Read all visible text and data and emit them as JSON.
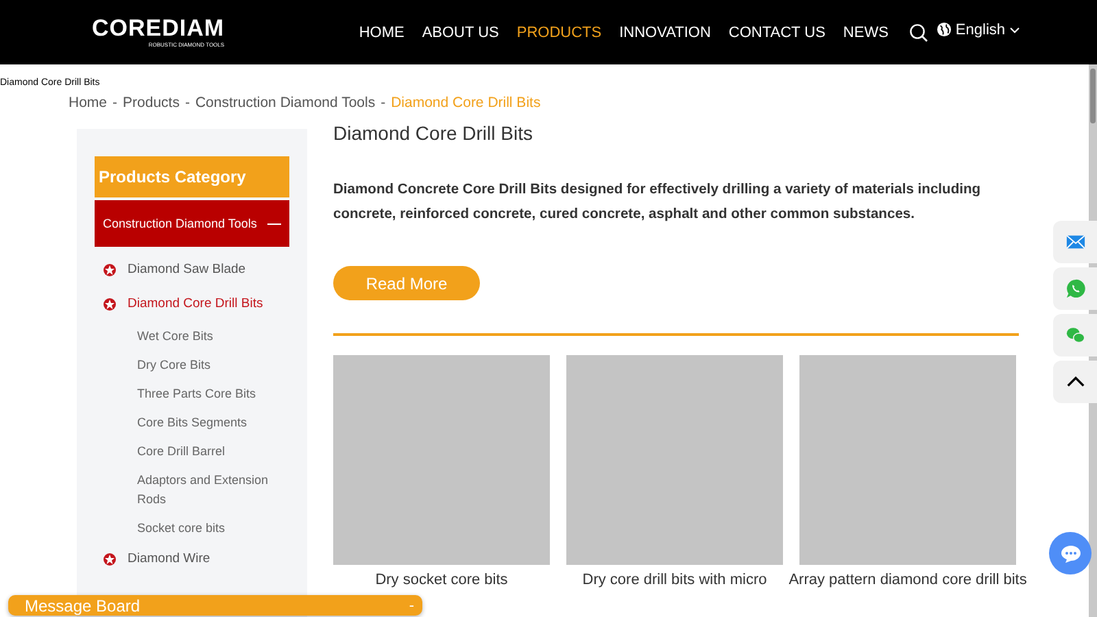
{
  "header": {
    "logo": "COREDIAM",
    "tagline": "ROBUSTIC DIAMOND TOOLS",
    "nav": [
      {
        "label": "HOME",
        "selected": false
      },
      {
        "label": "ABOUT US",
        "selected": false
      },
      {
        "label": "PRODUCTS",
        "selected": true
      },
      {
        "label": "INNOVATION",
        "selected": false
      },
      {
        "label": "CONTACT US",
        "selected": false
      },
      {
        "label": "NEWS",
        "selected": false
      }
    ],
    "language": "English"
  },
  "page_label": "Diamond Core Drill Bits",
  "breadcrumb": [
    {
      "kind": "link",
      "label": "Home",
      "selected": false
    },
    {
      "kind": "separator",
      "label": "-"
    },
    {
      "kind": "link",
      "label": "Products",
      "selected": false
    },
    {
      "kind": "separator",
      "label": "-"
    },
    {
      "kind": "link",
      "label": "Construction Diamond Tools",
      "selected": false
    },
    {
      "kind": "separator",
      "label": "-"
    },
    {
      "kind": "link",
      "label": "Diamond Core Drill Bits",
      "selected": true
    }
  ],
  "sidebar": {
    "title": "Products Category",
    "category": {
      "label": "Construction Diamond Tools",
      "expanded": true
    },
    "items": [
      {
        "label": "Diamond Saw Blade",
        "selected": false
      },
      {
        "label": "Diamond Core Drill Bits",
        "selected": true,
        "children": [
          {
            "label": "Wet Core Bits"
          },
          {
            "label": "Dry Core Bits"
          },
          {
            "label": "Three Parts Core Bits"
          },
          {
            "label": "Core Bits Segments"
          },
          {
            "label": "Core Drill Barrel"
          },
          {
            "label": "Adaptors and Extension Rods"
          },
          {
            "label": "Socket core bits"
          }
        ]
      },
      {
        "label": "Diamond Wire",
        "selected": false
      }
    ]
  },
  "content": {
    "title": "Diamond Core Drill Bits",
    "intro": "Diamond Concrete Core Drill Bits designed for effectively drilling a variety of materials including concrete, reinforced concrete, cured concrete, asphalt and other common substances.",
    "button": "Read More",
    "products": [
      {
        "title": "Dry socket core bits"
      },
      {
        "title": "Dry core drill bits with micro"
      },
      {
        "title": "Array pattern diamond core drill bits"
      }
    ]
  },
  "message_board": {
    "title": "Message Board",
    "toggle": "-"
  }
}
